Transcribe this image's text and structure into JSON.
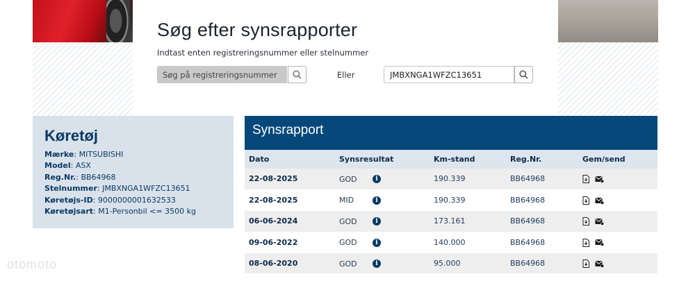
{
  "search": {
    "title": "Søg efter synsrapporter",
    "subtitle": "Indtast enten registreringsnummer eller stelnummer",
    "reg_placeholder": "Søg på registreringsnummer",
    "or_label": "Eller",
    "vin_value": "JMBXNGA1WFZC13651"
  },
  "vehicle": {
    "title": "Køretøj",
    "rows": [
      {
        "label": "Mærke",
        "value": "MITSUBISHI"
      },
      {
        "label": "Model",
        "value": "ASX"
      },
      {
        "label": "Reg.Nr.",
        "value": "BB64968"
      },
      {
        "label": "Stelnummer",
        "value": "JMBXNGA1WFZC13651"
      },
      {
        "label": "Køretøjs-ID",
        "value": "9000000001632533"
      },
      {
        "label": "Køretøjsart",
        "value": "M1-Personbil <= 3500 kg"
      }
    ]
  },
  "report": {
    "title": "Synsrapport",
    "columns": [
      "Dato",
      "Synsresultat",
      "Km-stand",
      "Reg.Nr.",
      "Gem/send"
    ],
    "rows": [
      {
        "date": "22-08-2025",
        "result": "GOD",
        "km": "190.339",
        "reg": "BB64968"
      },
      {
        "date": "22-08-2025",
        "result": "MID",
        "km": "190.339",
        "reg": "BB64968"
      },
      {
        "date": "06-06-2024",
        "result": "GOD",
        "km": "173.161",
        "reg": "BB64968"
      },
      {
        "date": "09-06-2022",
        "result": "GOD",
        "km": "140.000",
        "reg": "BB64968"
      },
      {
        "date": "08-06-2020",
        "result": "GOD",
        "km": "95.000",
        "reg": "BB64968"
      }
    ],
    "info_icon": "info-circle-icon",
    "download_icon": "pdf-download-icon",
    "email_icon": "envelope-send-icon"
  },
  "watermark": "otomoto",
  "colors": {
    "header_blue": "#064879",
    "panel_bg": "#d9e2eb",
    "text_blue": "#0b3a63"
  }
}
